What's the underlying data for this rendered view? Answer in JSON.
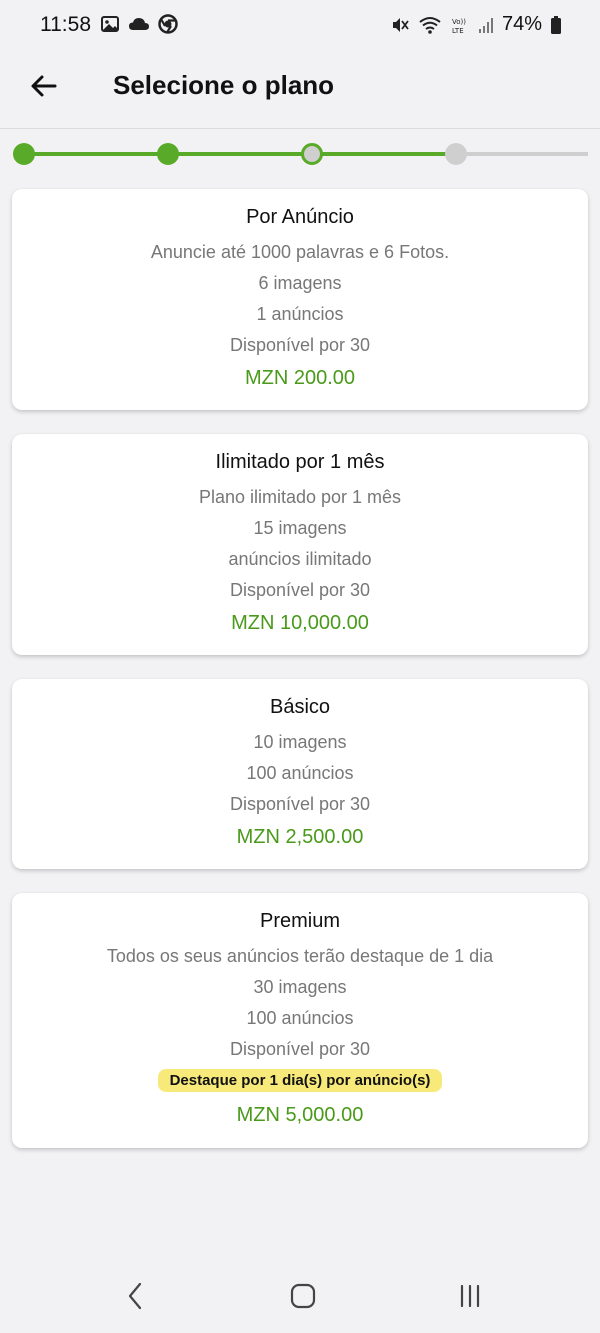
{
  "status_bar": {
    "time": "11:58",
    "battery": "74%",
    "left_icons": [
      "image-icon",
      "cloud-icon",
      "chrome-icon"
    ],
    "right_icons": [
      "mute-icon",
      "wifi-icon",
      "volte-icon",
      "signal-icon",
      "battery-icon"
    ]
  },
  "app_bar": {
    "title": "Selecione o plano",
    "back_icon": "arrow-left-icon"
  },
  "stepper": {
    "active_color": "#5aaa2a",
    "inactive_color": "#cfcfcf",
    "steps": [
      "completed",
      "completed",
      "current",
      "pending"
    ]
  },
  "plans": [
    {
      "title": "Por Anúncio",
      "lines": [
        "Anuncie até 1000 palavras e 6 Fotos.",
        "6 imagens",
        "1 anúncios",
        "Disponível por 30"
      ],
      "price": "MZN 200.00"
    },
    {
      "title": "Ilimitado por 1 mês",
      "lines": [
        "Plano ilimitado por 1 mês",
        "15 imagens",
        "anúncios ilimitado",
        "Disponível por 30"
      ],
      "price": "MZN 10,000.00"
    },
    {
      "title": "Básico",
      "lines": [
        "10 imagens",
        "100 anúncios",
        "Disponível por 30"
      ],
      "price": "MZN 2,500.00"
    },
    {
      "title": "Premium",
      "lines": [
        "Todos os seus anúncios terão destaque de 1 dia",
        "30 imagens",
        "100 anúncios",
        "Disponível por 30"
      ],
      "badge": "Destaque por 1 dia(s) por anúncio(s)",
      "price": "MZN 5,000.00"
    }
  ],
  "colors": {
    "price": "#4a9a1a",
    "badge_bg": "#f7e97a",
    "background": "#f2f2f4"
  },
  "nav_bar": {
    "icons": [
      "back-nav-icon",
      "home-nav-icon",
      "recents-nav-icon"
    ]
  }
}
